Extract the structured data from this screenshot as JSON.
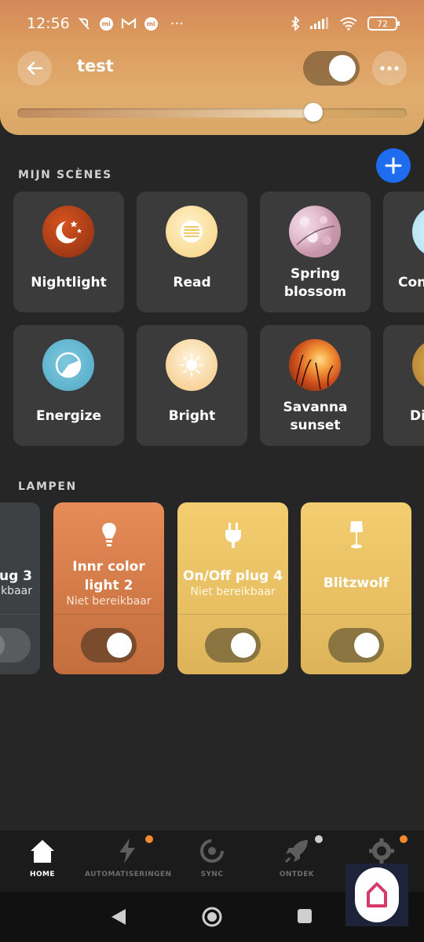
{
  "status_bar": {
    "time": "12:56",
    "dots": "···",
    "battery": "72"
  },
  "header": {
    "room_name": "test",
    "room_on": true,
    "brightness_fraction": 0.76
  },
  "sections": {
    "scenes_label": "MIJN SCÈNES",
    "lamps_label": "LAMPEN"
  },
  "scenes": [
    {
      "name": "Nightlight",
      "icon": "nightlight-icon"
    },
    {
      "name": "Read",
      "icon": "read-icon"
    },
    {
      "name": "Spring blossom",
      "icon": "spring-blossom-image"
    },
    {
      "name": "Con",
      "icon": "concentrate-icon"
    },
    {
      "name": "Energize",
      "icon": "energize-icon"
    },
    {
      "name": "Bright",
      "icon": "bright-icon"
    },
    {
      "name": "Savanna sunset",
      "icon": "savanna-sunset-image"
    },
    {
      "name": "Di",
      "icon": "dimmed-icon"
    }
  ],
  "lamps": [
    {
      "name": "lug 3",
      "status": "kbaar",
      "on": false
    },
    {
      "name": "Innr color light 2",
      "status": "Niet bereikbaar",
      "on": true
    },
    {
      "name": "On/Off plug 4",
      "status": "Niet bereikbaar",
      "on": true
    },
    {
      "name": "Blitzwolf",
      "status": "",
      "on": true
    }
  ],
  "nav": {
    "items": [
      {
        "label": "HOME",
        "icon": "home-icon",
        "active": true
      },
      {
        "label": "AUTOMATISERINGEN",
        "icon": "automation-icon",
        "active": false
      },
      {
        "label": "SYNC",
        "icon": "sync-icon",
        "active": false
      },
      {
        "label": "ONTDEK",
        "icon": "rocket-icon",
        "active": false
      },
      {
        "label": "",
        "icon": "settings-icon",
        "active": false
      }
    ]
  },
  "colors": {
    "header_orange": "#d4895a",
    "add_button_blue": "#1e6cf0",
    "lamp_orange": "#d48150",
    "lamp_yellow": "#e6c067",
    "notification_orange": "#f08a2c"
  }
}
